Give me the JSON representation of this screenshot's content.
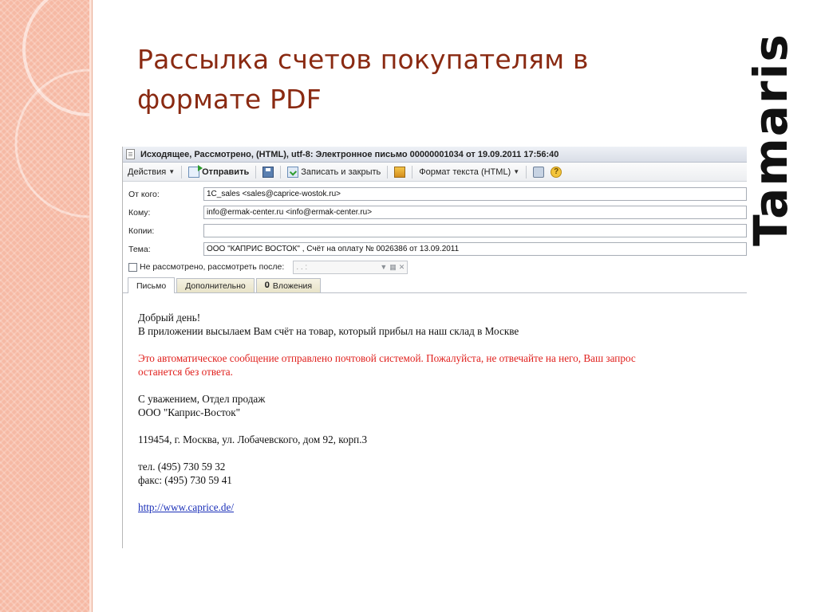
{
  "slide": {
    "title_line1": "Рассылка счетов покупателям в",
    "title_line2": "формате PDF",
    "logo_text": "Tamaris"
  },
  "window": {
    "title": "Исходящее, Рассмотрено, (HTML), utf-8: Электронное письмо 00000001034 от 19.09.2011 17:56:40"
  },
  "toolbar": {
    "actions_label": "Действия",
    "send_label": "Отправить",
    "save_close_label": "Записать и закрыть",
    "format_label": "Формат текста (HTML)",
    "help_glyph": "?"
  },
  "fields": {
    "from_label": "От кого:",
    "from_value": "1C_sales <sales@caprice-wostok.ru>",
    "to_label": "Кому:",
    "to_value": "info@ermak-center.ru <info@ermak-center.ru>",
    "cc_label": "Копии:",
    "cc_value": "",
    "subject_label": "Тема:",
    "subject_value": "ООО \"КАПРИС ВОСТОК\" , Счёт на оплату № 0026386 от 13.09.2011",
    "not_reviewed_label": "Не рассмотрено, рассмотреть после:",
    "date_placeholder": ".  .      :"
  },
  "tabs": [
    {
      "label": "Письмо"
    },
    {
      "label": "Дополнительно"
    },
    {
      "label": "Вложения"
    }
  ],
  "message": {
    "greeting": "Добрый день!",
    "line1": "В приложении высылаем Вам счёт на товар, который прибыл на наш склад в Москве",
    "auto_line1": "Это автоматическое сообщение отправлено почтовой системой. Пожалуйста, не отвечайте на него, Ваш запрос",
    "auto_line2": "останется без ответа.",
    "regards": "С уважением, Отдел продаж",
    "company": "ООО \"Каприс-Восток\"",
    "address": "119454, г. Москва, ул. Лобачевского, дом 92, корп.3",
    "phone": "тел.  (495) 730 59 32",
    "fax": "факс: (495) 730 59 41",
    "url": "http://www.caprice.de/"
  },
  "colors": {
    "band": "#f6b9a4",
    "title": "#8a2a12",
    "warning_text": "#e0201d",
    "link": "#1a2fb8"
  }
}
